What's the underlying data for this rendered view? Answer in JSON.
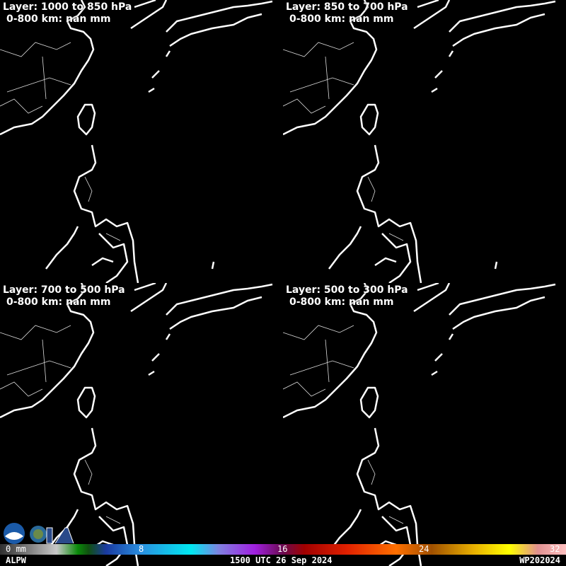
{
  "panels": [
    {
      "layer": "Layer: 1000 to 850 hPa",
      "stat": "0-800 km: nan mm"
    },
    {
      "layer": "Layer: 850 to 700 hPa",
      "stat": "0-800 km: nan mm"
    },
    {
      "layer": "Layer: 700 to 500 hPa",
      "stat": "0-800 km: nan mm"
    },
    {
      "layer": "Layer: 500 to 300 hPa",
      "stat": "0-800 km: nan mm"
    }
  ],
  "colorbar": {
    "ticks": [
      "0 mm",
      "8",
      "16",
      "24",
      "32"
    ]
  },
  "footer": {
    "product": "ALPW",
    "time": "1500 UTC 26 Sep 2024",
    "storm": "WP202024"
  },
  "logos": [
    "NOAA",
    "CIRA"
  ]
}
